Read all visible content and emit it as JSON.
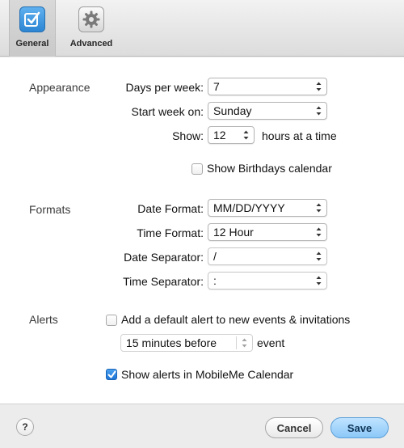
{
  "toolbar": {
    "general_label": "General",
    "advanced_label": "Advanced",
    "general_icon": "checkbox-calendar-icon",
    "advanced_icon": "gear-icon"
  },
  "appearance": {
    "section_label": "Appearance",
    "days_per_week_label": "Days per week:",
    "days_per_week_value": "7",
    "start_week_label": "Start week on:",
    "start_week_value": "Sunday",
    "show_label": "Show:",
    "show_value": "12",
    "hours_suffix": "hours at a time",
    "birthdays_label": "Show Birthdays calendar",
    "birthdays_checked": false
  },
  "formats": {
    "section_label": "Formats",
    "date_format_label": "Date Format:",
    "date_format_value": "MM/DD/YYYY",
    "time_format_label": "Time Format:",
    "time_format_value": "12 Hour",
    "date_separator_label": "Date Separator:",
    "date_separator_value": "/",
    "time_separator_label": "Time Separator:",
    "time_separator_value": ":"
  },
  "alerts": {
    "section_label": "Alerts",
    "default_alert_label": "Add a default alert to new events & invitations",
    "default_alert_checked": false,
    "alert_time_value": "15 minutes before",
    "event_suffix": "event",
    "show_alerts_label": "Show alerts in MobileMe Calendar",
    "show_alerts_checked": true
  },
  "footer": {
    "help_label": "?",
    "cancel_label": "Cancel",
    "save_label": "Save"
  },
  "colors": {
    "accent": "#2d86d4",
    "save_button": "#8cc8f8"
  }
}
